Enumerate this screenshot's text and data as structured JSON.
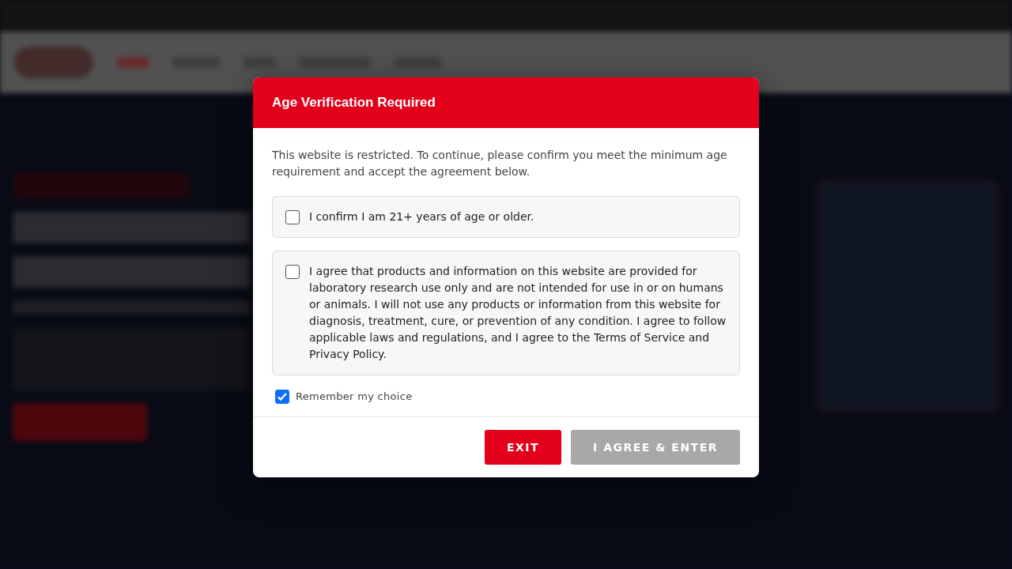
{
  "dialog": {
    "title": "Age Verification Required",
    "intro": "This website is restricted. To continue, please confirm you meet the minimum age requirement and accept the agreement below.",
    "agreements": [
      {
        "label": "I confirm I am 21+ years of age or older.",
        "checked": false
      },
      {
        "label": "I agree that products and information on this website are provided for laboratory research use only and are not intended for use in or on humans or animals. I will not use any products or information from this website for diagnosis, treatment, cure, or prevention of any condition. I agree to follow applicable laws and regulations, and I agree to the Terms of Service and Privacy Policy.",
        "checked": false
      }
    ],
    "remember": {
      "label": "Remember my choice",
      "checked": true
    },
    "buttons": [
      {
        "label": "EXIT",
        "disabled": false
      },
      {
        "label": "I AGREE & ENTER",
        "disabled": true
      }
    ]
  }
}
